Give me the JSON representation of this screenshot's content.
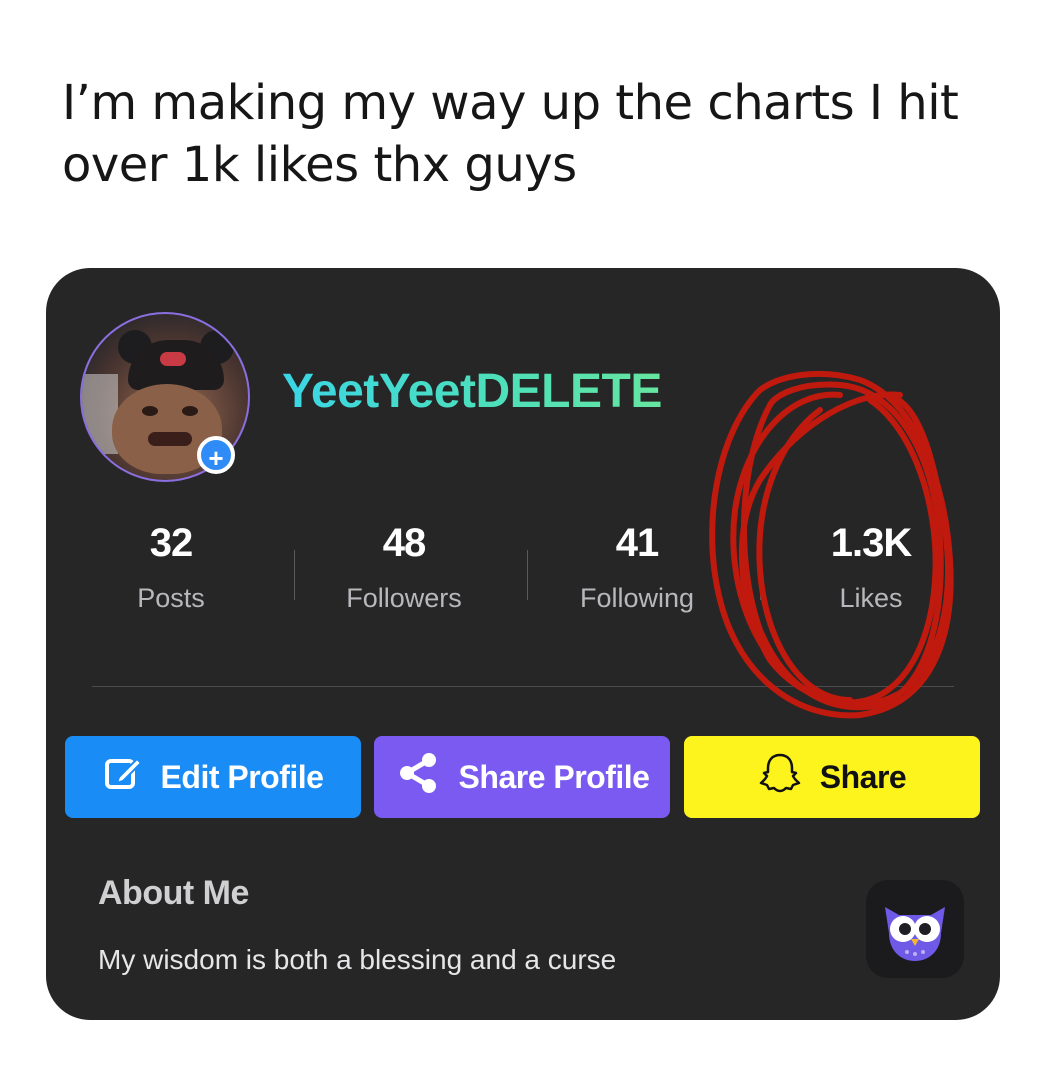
{
  "caption": "I’m making my way up the charts I hit over 1k likes thx guys",
  "profile": {
    "username": "YeetYeetDELETE",
    "avatar_badge": "+"
  },
  "stats": [
    {
      "value": "32",
      "label": "Posts"
    },
    {
      "value": "48",
      "label": "Followers"
    },
    {
      "value": "41",
      "label": "Following"
    },
    {
      "value": "1.3K",
      "label": "Likes"
    }
  ],
  "buttons": {
    "edit": "Edit Profile",
    "share_profile": "Share Profile",
    "share": "Share"
  },
  "about": {
    "title": "About Me",
    "text": "My wisdom is both a blessing and a curse"
  },
  "colors": {
    "card_bg": "#262626",
    "edit_btn": "#1a8cf5",
    "share_profile_btn": "#7a5af0",
    "share_btn": "#fdf41d",
    "username_gradient_start": "#3ad6e6",
    "username_gradient_end": "#66e6a0",
    "scribble": "#c0190e"
  },
  "icons": {
    "edit": "pencil-square-icon",
    "share_profile": "share-nodes-icon",
    "share": "snapchat-ghost-icon",
    "app": "owl-app-icon"
  }
}
